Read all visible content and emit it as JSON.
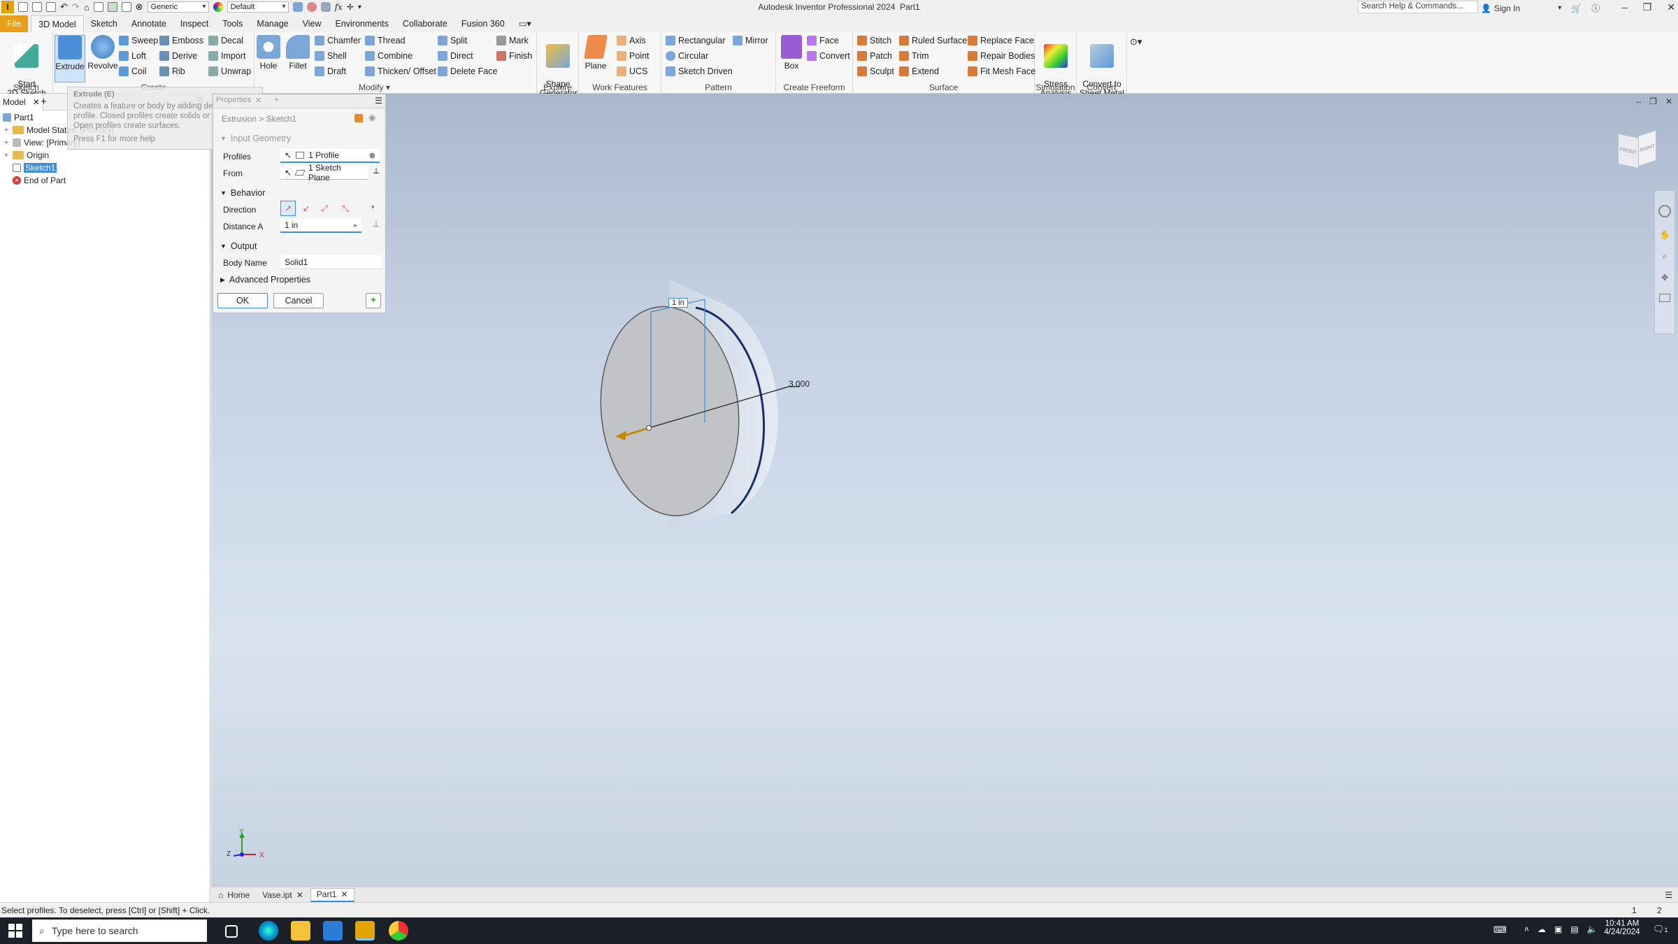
{
  "app": {
    "title": "Autodesk Inventor Professional 2024",
    "document": "Part1",
    "qat_appearance": "Generic",
    "qat_style": "Default",
    "help_search_placeholder": "Search Help & Commands...",
    "signin": "Sign In"
  },
  "tabs": [
    "File",
    "3D Model",
    "Sketch",
    "Annotate",
    "Inspect",
    "Tools",
    "Manage",
    "View",
    "Environments",
    "Collaborate",
    "Fusion 360"
  ],
  "ribbon": {
    "sketch": {
      "label": "Sketch",
      "start": "Start\n2D Sketch"
    },
    "create": {
      "label": "Create",
      "extrude": "Extrude",
      "revolve": "Revolve",
      "sweep": "Sweep",
      "loft": "Loft",
      "coil": "Coil",
      "emboss": "Emboss",
      "derive": "Derive",
      "rib": "Rib",
      "decal": "Decal",
      "import": "Import",
      "unwrap": "Unwrap"
    },
    "modify": {
      "label": "Modify",
      "hole": "Hole",
      "fillet": "Fillet",
      "chamfer": "Chamfer",
      "shell": "Shell",
      "draft": "Draft",
      "thread": "Thread",
      "combine": "Combine",
      "thicken": "Thicken/ Offset",
      "split": "Split",
      "direct": "Direct",
      "delete_face": "Delete Face"
    },
    "explore": {
      "label": "Explore",
      "mark": "Mark",
      "finish": "Finish",
      "shape_gen": "Shape\nGenerator"
    },
    "work": {
      "label": "Work Features",
      "plane": "Plane",
      "axis": "Axis",
      "point": "Point",
      "ucs": "UCS"
    },
    "pattern": {
      "label": "Pattern",
      "rect": "Rectangular",
      "circular": "Circular",
      "sketch_driven": "Sketch Driven",
      "mirror": "Mirror"
    },
    "freeform": {
      "label": "Create Freeform",
      "box": "Box",
      "face": "Face",
      "convert": "Convert"
    },
    "surface": {
      "label": "Surface",
      "stitch": "Stitch",
      "patch": "Patch",
      "sculpt": "Sculpt",
      "ruled": "Ruled Surface",
      "trim": "Trim",
      "extend": "Extend",
      "replace": "Replace Face",
      "repair": "Repair Bodies",
      "fitmesh": "Fit Mesh Face"
    },
    "simulation": {
      "label": "Simulation",
      "stress": "Stress\nAnalysis"
    },
    "convert": {
      "label": "Convert",
      "sheet": "Convert to\nSheet Metal"
    }
  },
  "browser": {
    "tab": "Model",
    "items": [
      "Part1",
      "Model States: [Primary]",
      "View: [Primary]",
      "Origin",
      "Sketch1",
      "End of Part"
    ]
  },
  "tooltip": {
    "title": "Extrude (E)",
    "desc": "Creates a feature or body by adding depth to a profile. Closed profiles create solids or surfaces. Open profiles create surfaces.",
    "help": "Press F1 for more help"
  },
  "properties": {
    "tab": "Properties",
    "header": "Extrusion > Sketch1",
    "input_geometry": "Input Geometry",
    "profiles_label": "Profiles",
    "profiles_value": "1 Profile",
    "from_label": "From",
    "from_value": "1 Sketch Plane",
    "behavior": "Behavior",
    "direction_label": "Direction",
    "distance_label": "Distance A",
    "distance_value": "1 in",
    "output": "Output",
    "body_label": "Body Name",
    "body_value": "Solid1",
    "advanced": "Advanced Properties",
    "ok": "OK",
    "cancel": "Cancel"
  },
  "viewport": {
    "dim_depth": "1 in",
    "dim_diameter": "3.000",
    "viewcube_front": "FRONT",
    "viewcube_right": "RIGHT",
    "axis_x": "X",
    "axis_y": "Y",
    "axis_z": "Z"
  },
  "doc_tabs": [
    "Home",
    "Vase.ipt",
    "Part1"
  ],
  "status": {
    "text": "Select profiles. To deselect, press [Ctrl] or [Shift] + Click.",
    "n1": "1",
    "n2": "2"
  },
  "taskbar": {
    "search": "Type here to search",
    "time": "10:41 AM",
    "date": "4/24/2024",
    "notif": "1"
  },
  "colors": {
    "accent": "#3d8de0",
    "file_tab": "#e89e1a",
    "preview_edge": "#1a2d6b"
  }
}
